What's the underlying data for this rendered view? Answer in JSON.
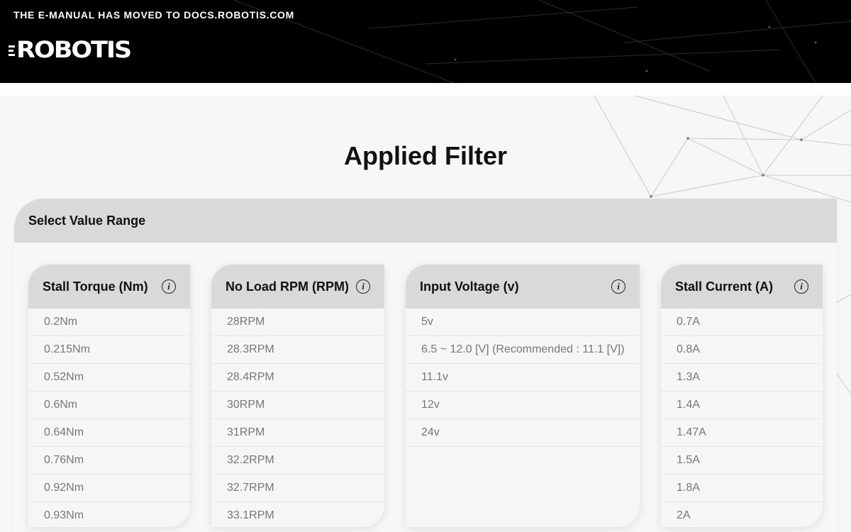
{
  "banner": {
    "notice": "THE E-MANUAL HAS MOVED TO DOCS.ROBOTIS.COM",
    "logo_text": "ROBOTIS"
  },
  "page": {
    "title": "Applied Filter"
  },
  "filter_panel": {
    "header": "Select Value Range",
    "groups": [
      {
        "title": "Stall Torque (Nm)",
        "info_icon": "info-icon",
        "options": [
          "0.2Nm",
          "0.215Nm",
          "0.52Nm",
          "0.6Nm",
          "0.64Nm",
          "0.76Nm",
          "0.92Nm",
          "0.93Nm"
        ]
      },
      {
        "title": "No Load RPM (RPM)",
        "info_icon": "info-icon",
        "options": [
          "28RPM",
          "28.3RPM",
          "28.4RPM",
          "30RPM",
          "31RPM",
          "32.2RPM",
          "32.7RPM",
          "33.1RPM"
        ]
      },
      {
        "title": "Input Voltage (v)",
        "info_icon": "info-icon",
        "options": [
          "5v",
          "6.5 ~ 12.0 [V] (Recommended : 11.1 [V])",
          "11.1v",
          "12v",
          "24v"
        ]
      },
      {
        "title": "Stall Current (A)",
        "info_icon": "info-icon",
        "options": [
          "0.7A",
          "0.8A",
          "1.3A",
          "1.4A",
          "1.47A",
          "1.5A",
          "1.8A",
          "2A"
        ]
      }
    ]
  },
  "colors": {
    "header_bg": "#000000",
    "panel_header_bg": "#d9d9d9",
    "card_bg": "#f6f6f6",
    "option_text": "#777777"
  }
}
